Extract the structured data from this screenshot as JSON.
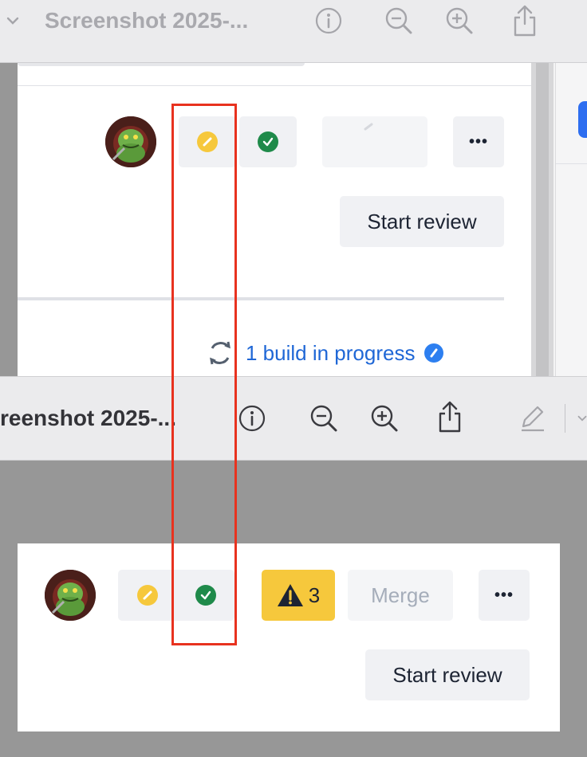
{
  "window_top": {
    "title": "Screenshot 2025-...",
    "icons": [
      "chevron-down-icon",
      "info-icon",
      "zoom-out-icon",
      "zoom-in-icon",
      "share-icon"
    ]
  },
  "window_bottom": {
    "title": "reenshot 2025-...",
    "icons": [
      "info-icon",
      "zoom-out-icon",
      "zoom-in-icon",
      "share-icon",
      "markup-pencil-icon",
      "chevron-down-icon"
    ]
  },
  "panel_top": {
    "start_review_label": "Start review",
    "more_label": "•••",
    "build_status": "1 build in progress"
  },
  "panel_bottom": {
    "warning_count": "3",
    "merge_label": "Merge",
    "more_label": "•••",
    "start_review_label": "Start review"
  },
  "colors": {
    "highlight_box": "#e8321f",
    "needs_work": "#f6c83c",
    "approved": "#1f8a4a",
    "warning_bg": "#f6c83c",
    "link": "#1f67d6"
  }
}
